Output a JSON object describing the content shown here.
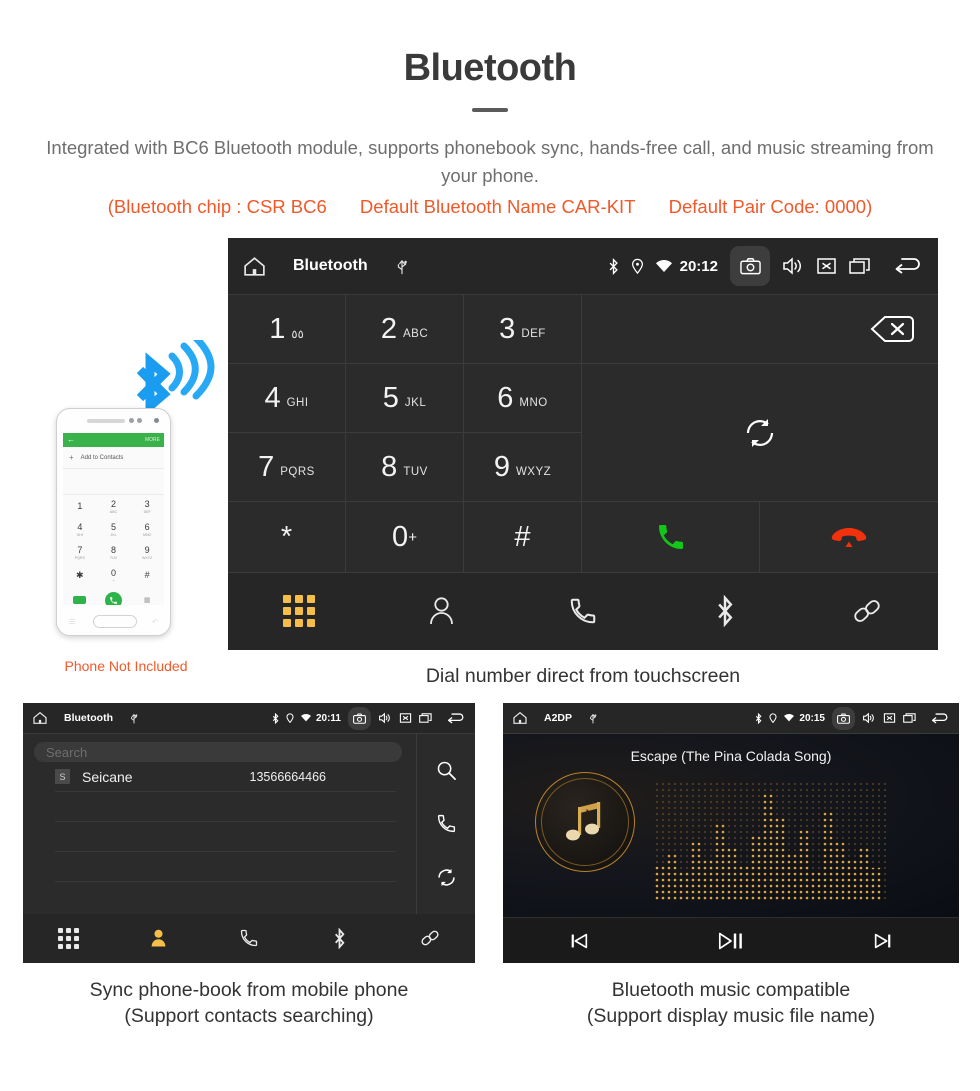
{
  "header": {
    "title": "Bluetooth",
    "subtitle": "Integrated with BC6 Bluetooth module, supports phonebook sync, hands-free call, and music streaming from your phone.",
    "spec_chip": "(Bluetooth chip : CSR BC6",
    "spec_name": "Default Bluetooth Name CAR-KIT",
    "spec_pair": "Default Pair Code: 0000)"
  },
  "phone_mock": {
    "add_to_contacts": "Add to Contacts",
    "more": "MORE",
    "not_included": "Phone Not Included",
    "keys": [
      {
        "digit": "1",
        "letters": ""
      },
      {
        "digit": "2",
        "letters": "ABC"
      },
      {
        "digit": "3",
        "letters": "DEF"
      },
      {
        "digit": "4",
        "letters": "GHI"
      },
      {
        "digit": "5",
        "letters": "JKL"
      },
      {
        "digit": "6",
        "letters": "MNO"
      },
      {
        "digit": "7",
        "letters": "PQRS"
      },
      {
        "digit": "8",
        "letters": "TUV"
      },
      {
        "digit": "9",
        "letters": "WXYZ"
      },
      {
        "digit": "*",
        "letters": ""
      },
      {
        "digit": "0",
        "letters": "+"
      },
      {
        "digit": "#",
        "letters": ""
      }
    ]
  },
  "dialer": {
    "statusbar": {
      "title": "Bluetooth",
      "time": "20:12"
    },
    "keys": [
      {
        "digit": "1",
        "letters": "٥٥"
      },
      {
        "digit": "2",
        "letters": "ABC"
      },
      {
        "digit": "3",
        "letters": "DEF"
      },
      {
        "digit": "4",
        "letters": "GHI"
      },
      {
        "digit": "5",
        "letters": "JKL"
      },
      {
        "digit": "6",
        "letters": "MNO"
      },
      {
        "digit": "7",
        "letters": "PQRS"
      },
      {
        "digit": "8",
        "letters": "TUV"
      },
      {
        "digit": "9",
        "letters": "WXYZ"
      },
      {
        "digit": "*",
        "letters": ""
      },
      {
        "digit": "0",
        "letters": "+"
      },
      {
        "digit": "#",
        "letters": ""
      }
    ],
    "caption": "Dial number direct from touchscreen",
    "colors": {
      "call_green": "#12c61a",
      "hangup_red": "#f2310d",
      "tab_active": "#f5be49"
    }
  },
  "phonebook": {
    "statusbar": {
      "title": "Bluetooth",
      "time": "20:11"
    },
    "search_placeholder": "Search",
    "contact": {
      "initial": "S",
      "name": "Seicane",
      "number": "13566664466"
    },
    "caption_line1": "Sync phone-book from mobile phone",
    "caption_line2": "(Support contacts searching)"
  },
  "music": {
    "statusbar": {
      "title": "A2DP",
      "time": "20:15"
    },
    "track_title": "Escape (The Pina Colada Song)",
    "caption_line1": "Bluetooth music compatible",
    "caption_line2": "(Support display music file name)",
    "accent": "#c08a2e"
  }
}
